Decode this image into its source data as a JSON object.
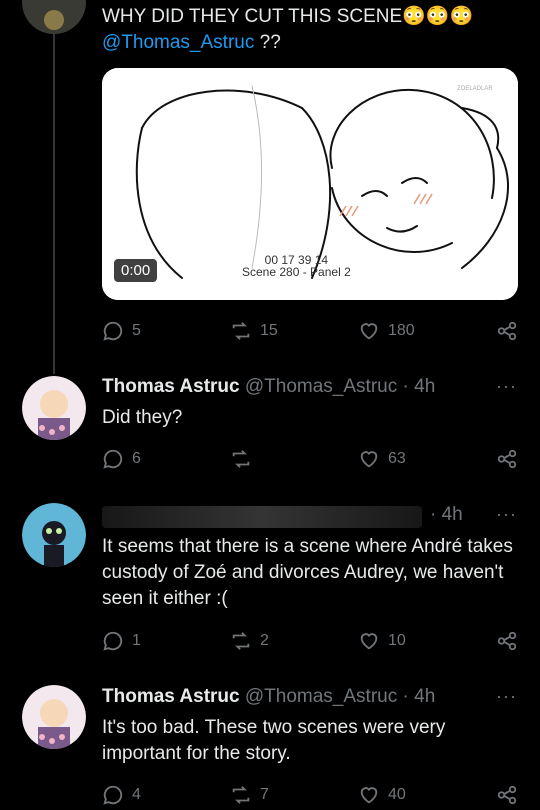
{
  "tweet_main": {
    "text_line1": "WHY DID THEY CUT THIS SCENE",
    "emojis": [
      "😳",
      "😳",
      "😳"
    ],
    "mention": "@Thomas_Astruc",
    "mention_suffix": " ??",
    "video": {
      "time": "0:00",
      "timecode": "00 17 39 14",
      "scene_label": "Scene 280 - Panel 2",
      "watermark": "ZOELADLAR"
    },
    "actions": {
      "replies": "5",
      "retweets": "15",
      "likes": "180"
    }
  },
  "reply1": {
    "name": "Thomas Astruc",
    "handle": "@Thomas_Astruc",
    "time": "· 4h",
    "text": "Did they?",
    "actions": {
      "replies": "6",
      "retweets": "",
      "likes": "63"
    }
  },
  "reply2": {
    "time": "· 4h",
    "text": "It seems that there is a scene where André takes custody of Zoé and divorces Audrey, we haven't seen it either :(",
    "actions": {
      "replies": "1",
      "retweets": "2",
      "likes": "10"
    }
  },
  "reply3": {
    "name": "Thomas Astruc",
    "handle": "@Thomas_Astruc",
    "time": "· 4h",
    "text": "It's too bad. These two scenes were very important for the story.",
    "actions": {
      "replies": "4",
      "retweets": "7",
      "likes": "40"
    }
  },
  "more_label": "···",
  "colors": {
    "background": "#000000",
    "text": "#e7e9ea",
    "muted": "#71767b",
    "link": "#1d9bf0"
  }
}
